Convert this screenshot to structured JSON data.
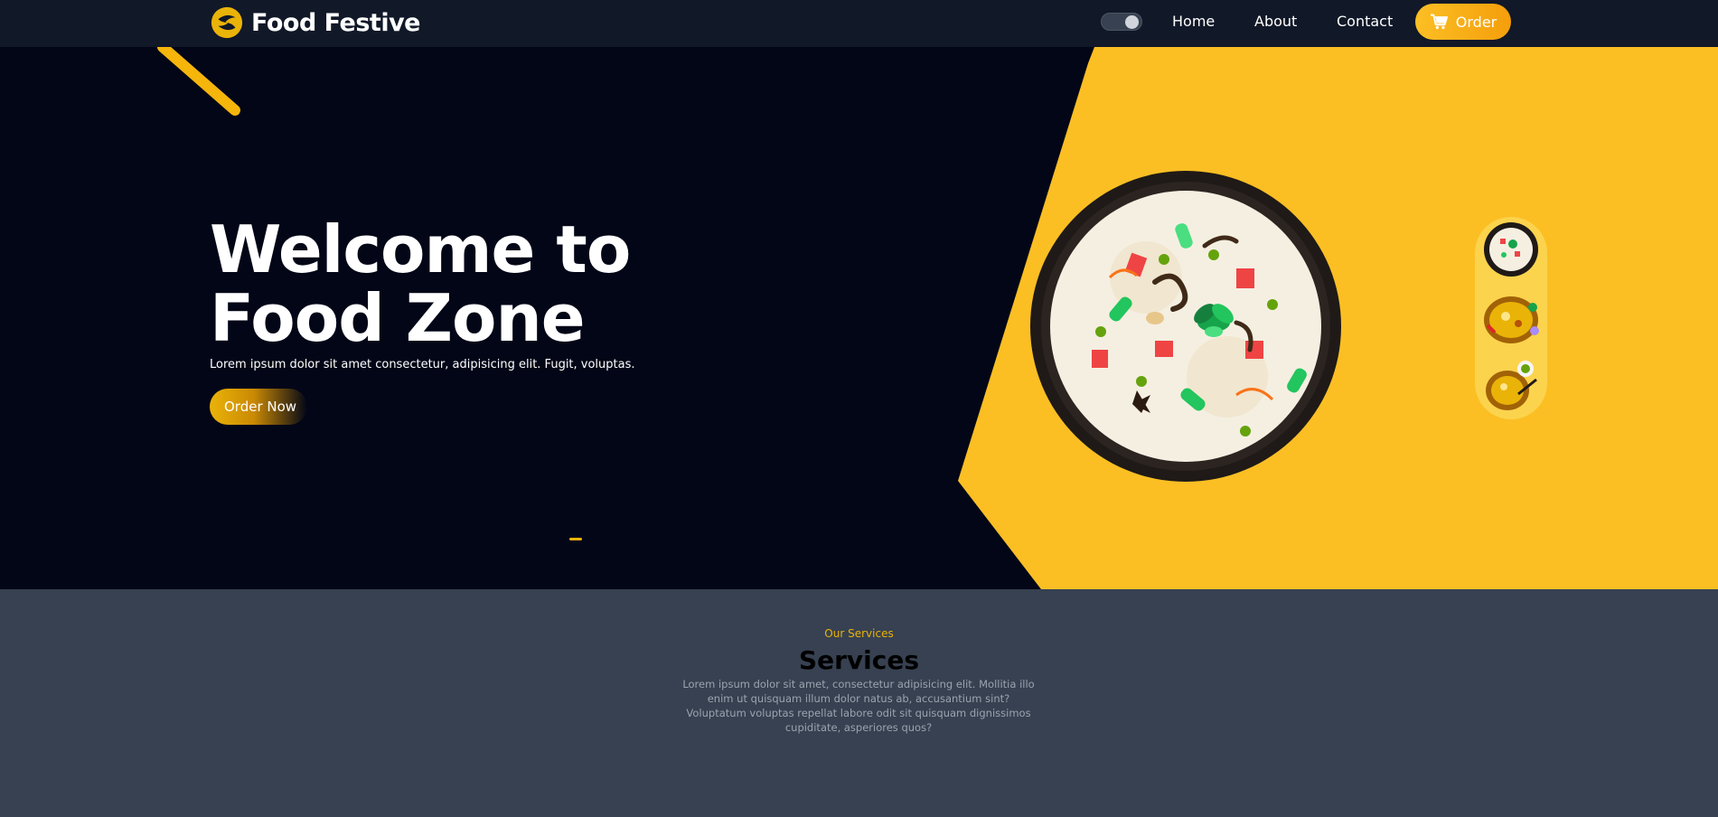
{
  "navbar": {
    "brand": "Food Festive",
    "links": {
      "home": "Home",
      "about": "About",
      "contact": "Contact"
    },
    "order_label": "Order",
    "toggle_state": "on"
  },
  "hero": {
    "title": "Welcome to Food Zone",
    "subtitle": "Lorem ipsum dolor sit amet consectetur, adipisicing elit. Fugit, voluptas.",
    "cta_label": "Order Now",
    "thumbnails": [
      "biryani-bowl",
      "biryani-plate",
      "biryani-plate-spoon"
    ]
  },
  "services": {
    "eyebrow": "Our Services",
    "title": "Services",
    "description": "Lorem ipsum dolor sit amet, consectetur adipisicing elit. Mollitia illo enim ut quisquam illum dolor natus ab, accusantium sint? Voluptatum voluptas repellat labore odit sit quisquam dignissimos cupiditate, asperiores quos?"
  },
  "colors": {
    "navbar_bg": "#111827",
    "hero_bg": "#020617",
    "accent_yellow": "#fbbf24",
    "services_bg": "#374151"
  }
}
